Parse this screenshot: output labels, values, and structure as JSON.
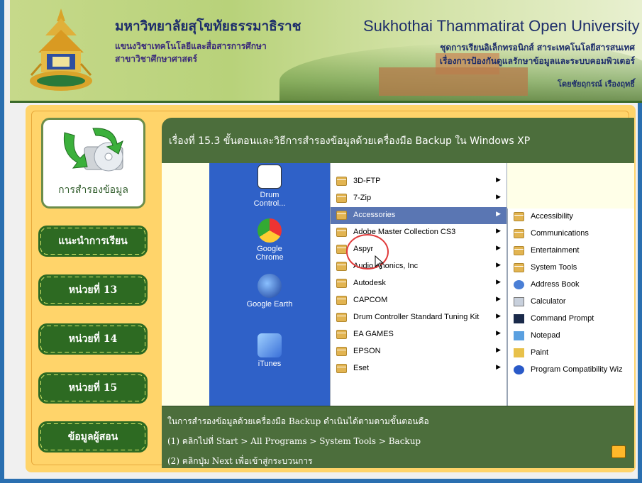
{
  "header": {
    "th_title": "มหาวิทยาลัยสุโขทัยธรรมาธิราช",
    "th_sub1": "แขนงวิชาเทคโนโลยีและสื่อสารการศึกษา",
    "th_sub2": "สาขาวิชาศึกษาศาสตร์",
    "en_title": "Sukhothai  Thammatirat  Open  University",
    "right_line1": "ชุดการเรียนอิเล็กทรอนิกส์ สาระเทคโนโลยีสารสนเทศ",
    "right_line2": "เรื่องการป้องกันดูแลรักษาข้อมูลและระบบคอมพิวเตอร์",
    "right_line3": "โดยชัยฤกรณ์ เรืองฤทธิ์"
  },
  "sidebar": {
    "home_label": "การสำรองข้อมูล",
    "items": [
      {
        "label": "แนะนำการเรียน"
      },
      {
        "label": "หน่วยที่ 13"
      },
      {
        "label": "หน่วยที่ 14"
      },
      {
        "label": "หน่วยที่ 15"
      },
      {
        "label": "ข้อมูลผู้สอน"
      }
    ]
  },
  "main": {
    "title": "เรื่องที่ 15.3 ขั้นตอนและวิธีการสำรองข้อมูลด้วยเครื่องมือ Backup ใน Windows XP",
    "desktop_icons": [
      {
        "label": "Drum\nControl...",
        "icon": "drum-control-icon"
      },
      {
        "label": "Google\nChrome",
        "icon": "chrome-icon"
      },
      {
        "label": "Google Earth",
        "icon": "google-earth-icon"
      },
      {
        "label": "iTunes",
        "icon": "itunes-icon"
      }
    ],
    "programs_menu": [
      {
        "label": "3D-FTP"
      },
      {
        "label": "7-Zip"
      },
      {
        "label": "Accessories",
        "selected": true
      },
      {
        "label": "Adobe Master Collection CS3"
      },
      {
        "label": "Aspyr"
      },
      {
        "label": "Audio Phonics, Inc"
      },
      {
        "label": "Autodesk"
      },
      {
        "label": "CAPCOM"
      },
      {
        "label": "Drum Controller Standard Tuning Kit"
      },
      {
        "label": "EA GAMES"
      },
      {
        "label": "EPSON"
      },
      {
        "label": "Eset"
      }
    ],
    "accessories_menu": [
      {
        "label": "Accessibility"
      },
      {
        "label": "Communications"
      },
      {
        "label": "Entertainment"
      },
      {
        "label": "System Tools"
      },
      {
        "label": "Address Book"
      },
      {
        "label": "Calculator"
      },
      {
        "label": "Command Prompt"
      },
      {
        "label": "Notepad"
      },
      {
        "label": "Paint"
      },
      {
        "label": "Program Compatibility Wiz"
      }
    ],
    "caption": {
      "line1": "ในการสำรองข้อมูลด้วยเครื่องมือ Backup ดำเนินได้ตามตามขั้นตอนคือ",
      "line2": "(1) คลิกไปที่ Start > All Programs > System Tools > Backup",
      "line3": "(2) คลิกปุ่ม Next เพื่อเข้าสู่กระบวนการ"
    }
  },
  "colors": {
    "dark_green": "#4c6e3c",
    "nav_green": "#2d6a22",
    "yellow_bg": "#ffd46a",
    "menu_select": "#5a76b3"
  }
}
